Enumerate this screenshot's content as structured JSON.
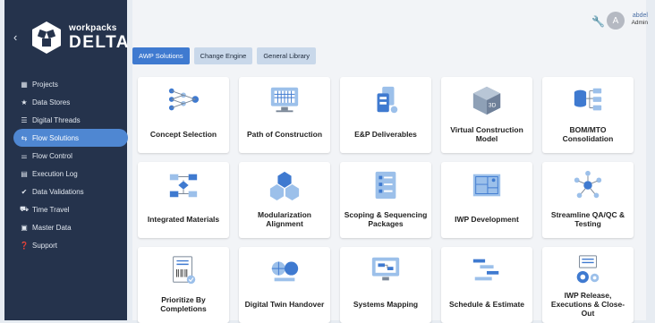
{
  "brand": {
    "line1": "workpacks",
    "line2": "DELTA"
  },
  "nav": [
    {
      "label": "Projects",
      "icon": "grid-icon",
      "active": false
    },
    {
      "label": "Data Stores",
      "icon": "star-icon",
      "active": false
    },
    {
      "label": "Digital Threads",
      "icon": "list-icon",
      "active": false
    },
    {
      "label": "Flow Solutions",
      "icon": "flow-icon",
      "active": true
    },
    {
      "label": "Flow Control",
      "icon": "sliders-icon",
      "active": false
    },
    {
      "label": "Execution Log",
      "icon": "log-icon",
      "active": false
    },
    {
      "label": "Data Validations",
      "icon": "check-icon",
      "active": false
    },
    {
      "label": "Time Travel",
      "icon": "car-icon",
      "active": false
    },
    {
      "label": "Master Data",
      "icon": "database-icon",
      "active": false
    },
    {
      "label": "Support",
      "icon": "help-icon",
      "active": false
    }
  ],
  "user": {
    "avatar": "A",
    "name": "abdel",
    "role": "Admin"
  },
  "tabs": [
    {
      "label": "AWP Solutions",
      "active": true
    },
    {
      "label": "Change Engine",
      "active": false
    },
    {
      "label": "General Library",
      "active": false
    }
  ],
  "cards": [
    {
      "label": "Concept Selection",
      "icon": "network-icon"
    },
    {
      "label": "Path of Construction",
      "icon": "monitor-grid-icon"
    },
    {
      "label": "E&P Deliverables",
      "icon": "tablet-stack-icon"
    },
    {
      "label": "Virtual Construction Model",
      "icon": "cube-3d-icon"
    },
    {
      "label": "BOM/MTO Consolidation",
      "icon": "database-flow-icon"
    },
    {
      "label": "Integrated Materials",
      "icon": "flowchart-icon"
    },
    {
      "label": "Modularization Alignment",
      "icon": "cubes-icon"
    },
    {
      "label": "Scoping & Sequencing Packages",
      "icon": "checklist-icon"
    },
    {
      "label": "IWP Development",
      "icon": "blueprint-icon"
    },
    {
      "label": "Streamline QA/QC & Testing",
      "icon": "hub-icon"
    },
    {
      "label": "Prioritize By Completions",
      "icon": "barcode-doc-icon"
    },
    {
      "label": "Digital Twin Handover",
      "icon": "globe-twin-icon"
    },
    {
      "label": "Systems Mapping",
      "icon": "monitor-map-icon"
    },
    {
      "label": "Schedule & Estimate",
      "icon": "gantt-icon"
    },
    {
      "label": "IWP Release, Executions & Close-Out",
      "icon": "gears-icon"
    }
  ],
  "colors": {
    "sidebar": "#25334c",
    "accent": "#3f7ad0",
    "tab": "#c9d8ea"
  }
}
